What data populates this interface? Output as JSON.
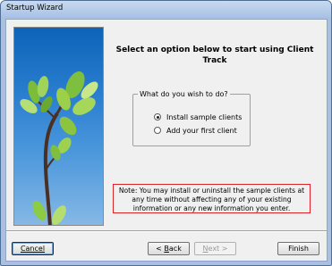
{
  "window": {
    "title": "Startup Wizard"
  },
  "heading": "Select an option below to start using Client Track",
  "group": {
    "label": "What do you wish to do?",
    "options": [
      {
        "label": "Install sample clients",
        "checked": true
      },
      {
        "label": "Add your first client",
        "checked": false
      }
    ]
  },
  "note": "Note: You may install or uninstall the sample clients at any time without affecting any of your existing information or any new information you enter.",
  "buttons": {
    "cancel": "Cancel",
    "back_prefix": "< ",
    "back_mnemonic": "B",
    "back_rest": "ack",
    "next_mnemonic": "N",
    "next_rest": "ext >",
    "finish": "Finish"
  },
  "colors": {
    "note_border": "#dd2222",
    "sky": "#2a7fd0",
    "title_bar": "#a9c2e4"
  }
}
